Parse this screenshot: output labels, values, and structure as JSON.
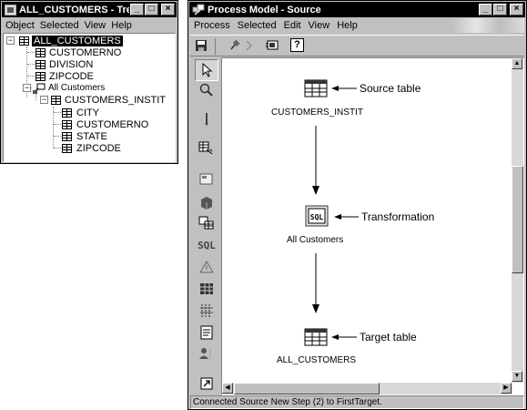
{
  "tree_window": {
    "title": "ALL_CUSTOMERS - Tree",
    "menu": [
      "Object",
      "Selected",
      "View",
      "Help"
    ],
    "nodes": [
      {
        "label": "ALL_CUSTOMERS",
        "selected": true
      },
      {
        "label": "CUSTOMERNO"
      },
      {
        "label": "DIVISION"
      },
      {
        "label": "ZIPCODE"
      },
      {
        "label": "All Customers"
      },
      {
        "label": "CUSTOMERS_INSTIT"
      },
      {
        "label": "CITY"
      },
      {
        "label": "CUSTOMERNO"
      },
      {
        "label": "STATE"
      },
      {
        "label": "ZIPCODE"
      }
    ]
  },
  "process_window": {
    "title": "Process Model - Source",
    "menu": [
      "Process",
      "Selected",
      "Edit",
      "View",
      "Help"
    ],
    "toolbar_icons": [
      "save-icon",
      "pin-icon",
      "link-icon",
      "projector-icon",
      "help-icon"
    ],
    "help_glyph": "?",
    "palette_icons": [
      "pointer-icon",
      "zoom-icon",
      "pen-icon",
      "table-copy-icon",
      "source-icon",
      "cube-icon",
      "tables-icon",
      "sql-icon",
      "warning-icon",
      "grid-icon",
      "columns-icon",
      "report-icon",
      "user-icon",
      "shortcut-icon"
    ],
    "palette_sql_text": "SQL",
    "canvas": {
      "source_label": "CUSTOMERS_INSTIT",
      "transform_label": "All Customers",
      "target_label": "ALL_CUSTOMERS",
      "sql_icon_text": "SQL",
      "annotation_source": "Source table",
      "annotation_transform": "Transformation",
      "annotation_target": "Target table"
    },
    "status_text": "Connected Source New Step (2) to FirstTarget."
  }
}
